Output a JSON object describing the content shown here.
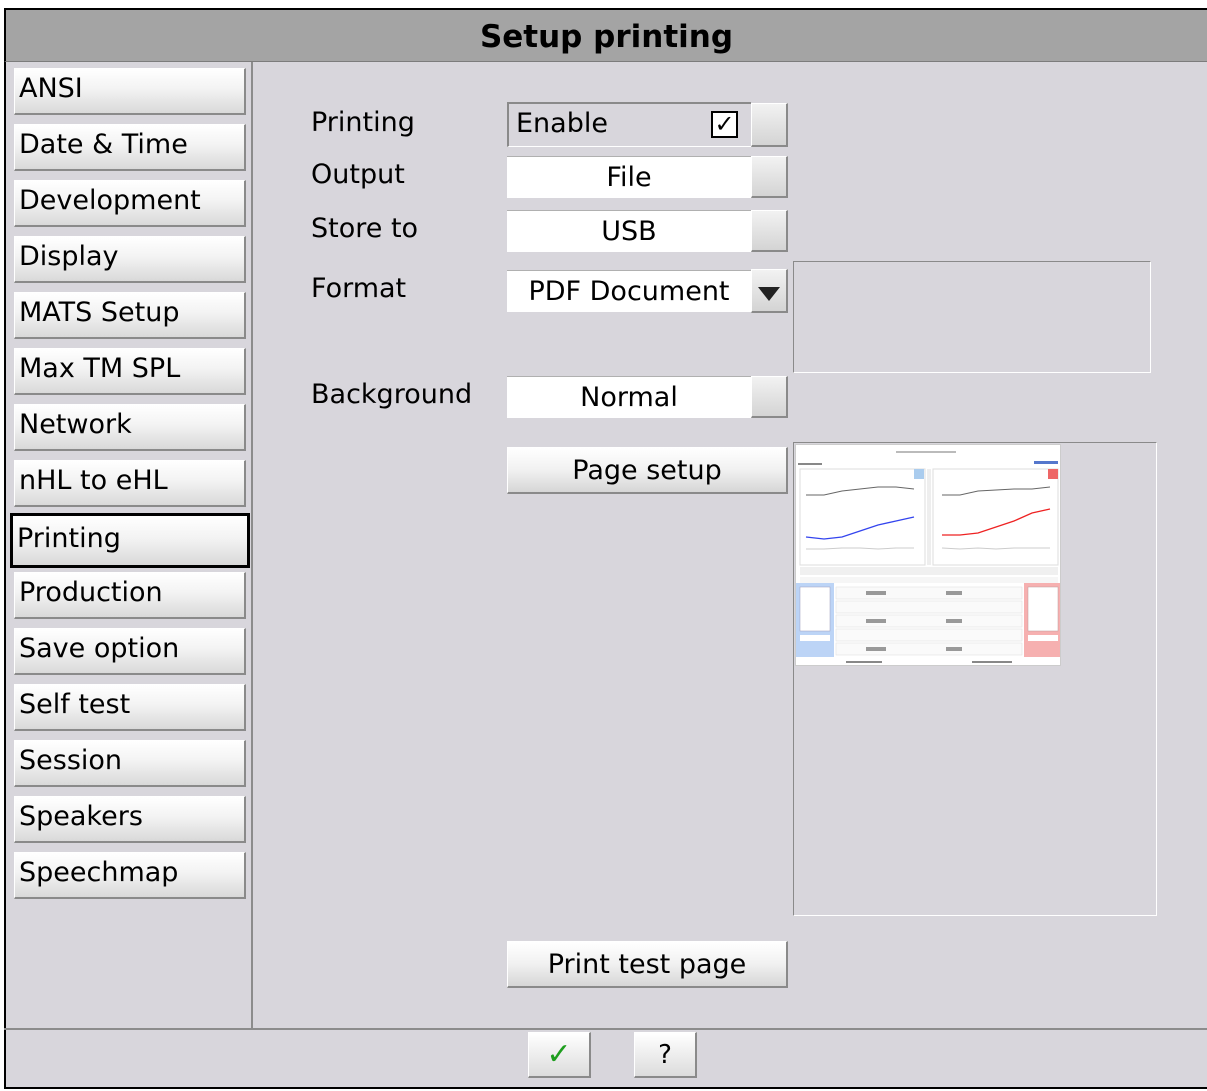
{
  "title": "Setup printing",
  "sidebar": {
    "items": [
      {
        "label": "ANSI"
      },
      {
        "label": "Date & Time"
      },
      {
        "label": "Development"
      },
      {
        "label": "Display"
      },
      {
        "label": "MATS Setup"
      },
      {
        "label": "Max TM SPL"
      },
      {
        "label": "Network"
      },
      {
        "label": "nHL to eHL"
      },
      {
        "label": "Printing",
        "active": true
      },
      {
        "label": "Production"
      },
      {
        "label": "Save option"
      },
      {
        "label": "Self test"
      },
      {
        "label": "Session"
      },
      {
        "label": "Speakers"
      },
      {
        "label": "Speechmap"
      }
    ]
  },
  "form": {
    "printing": {
      "label": "Printing",
      "value": "Enable",
      "checked": true,
      "check_glyph": "✓"
    },
    "output": {
      "label": "Output",
      "value": "File"
    },
    "store_to": {
      "label": "Store to",
      "value": "USB"
    },
    "format": {
      "label": "Format",
      "value": "PDF Document"
    },
    "background": {
      "label": "Background",
      "value": "Normal"
    }
  },
  "buttons": {
    "page_setup": "Page setup",
    "print_test_page": "Print test page"
  },
  "footer": {
    "ok_glyph": "✓",
    "help_label": "?"
  },
  "colors": {
    "window_bg": "#d8d6dc",
    "title_bg": "#a4a4a4",
    "left_series": "#3344ee",
    "right_series": "#ee2222",
    "ok_check": "#1e9e1e"
  },
  "icons": [
    "checkbox-checked-icon",
    "dropdown-arrow-icon",
    "checkmark-icon",
    "help-icon"
  ]
}
